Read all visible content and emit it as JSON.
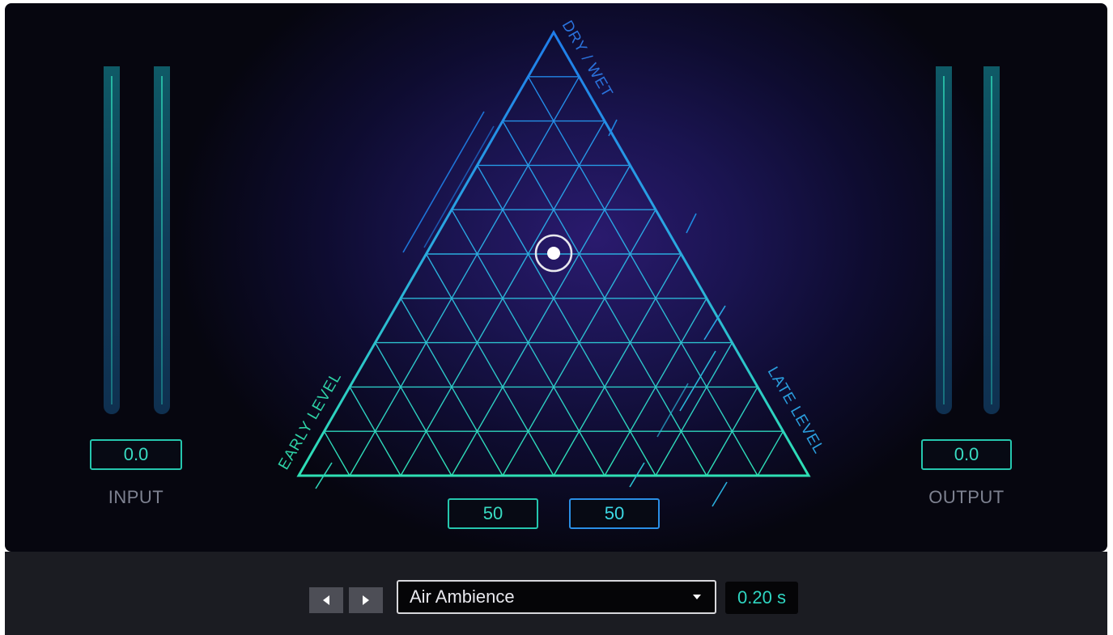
{
  "input": {
    "value": "0.0",
    "label": "INPUT",
    "level": 0
  },
  "output": {
    "value": "0.0",
    "label": "OUTPUT",
    "level": 0
  },
  "triangle": {
    "top_label": "DRY / WET",
    "left_label": "EARLY LEVEL",
    "right_label": "LATE LEVEL",
    "early_value": "50",
    "late_value": "50"
  },
  "preset": {
    "name": "Air Ambience",
    "prev_icon": "triangle-left-icon",
    "next_icon": "triangle-right-icon",
    "dropdown_icon": "caret-down-icon"
  },
  "decay_time": "0.20 s",
  "colors": {
    "teal": "#25c6ae",
    "blue": "#2a8fe6",
    "panel": "#0e0c30"
  }
}
